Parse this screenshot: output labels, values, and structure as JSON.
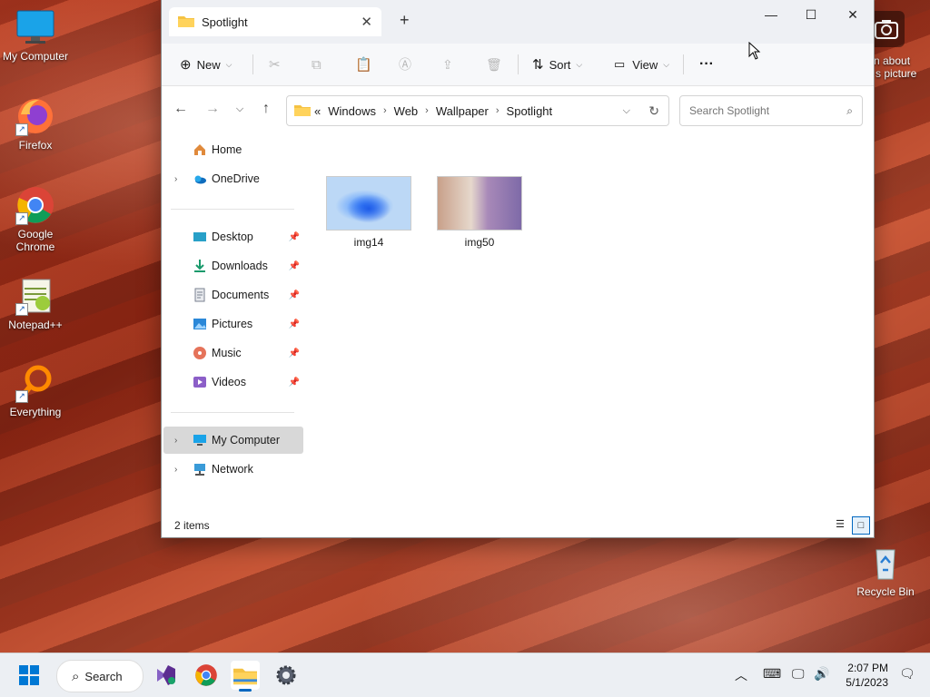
{
  "desktop": {
    "icons": [
      {
        "label": "My Computer"
      },
      {
        "label": "Firefox"
      },
      {
        "label": "Google Chrome"
      },
      {
        "label": "Notepad++"
      },
      {
        "label": "Everything"
      }
    ],
    "recycle_bin": "Recycle Bin",
    "spotlight_text": "rn about\ns picture"
  },
  "window": {
    "tab_title": "Spotlight",
    "toolbar": {
      "new_label": "New",
      "sort_label": "Sort",
      "view_label": "View",
      "more_label": "···"
    },
    "address": {
      "overflow": "«",
      "crumbs": [
        "Windows",
        "Web",
        "Wallpaper",
        "Spotlight"
      ]
    },
    "search": {
      "placeholder": "Search Spotlight"
    },
    "sidebar": {
      "home": "Home",
      "onedrive": "OneDrive",
      "quick": [
        "Desktop",
        "Downloads",
        "Documents",
        "Pictures",
        "Music",
        "Videos"
      ],
      "my_computer": "My Computer",
      "network": "Network"
    },
    "files": [
      {
        "name": "img14"
      },
      {
        "name": "img50"
      }
    ],
    "status": "2 items"
  },
  "taskbar": {
    "search_label": "Search",
    "time": "2:07 PM",
    "date": "5/1/2023"
  },
  "colors": {
    "accent": "#0067c0",
    "folder": "#f5c242"
  }
}
